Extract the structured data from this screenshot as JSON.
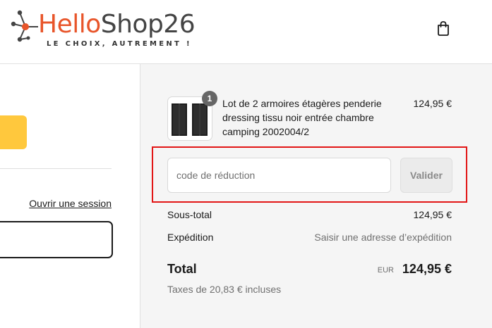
{
  "header": {
    "logo": {
      "part1": "Hello",
      "part2": "Shop26",
      "tagline": "LE CHOIX, AUTREMENT !"
    },
    "cart_icon": "shopping-bag-icon"
  },
  "left": {
    "login_link": "Ouvrir une session"
  },
  "summary": {
    "item": {
      "quantity": "1",
      "name": "Lot de 2 armoires étagères penderie dressing tissu noir entrée chambre camping 2002004/2",
      "price": "124,95 €"
    },
    "discount": {
      "placeholder": "code de réduction",
      "value": "",
      "button_label": "Valider"
    },
    "subtotal": {
      "label": "Sous-total",
      "value": "124,95 €"
    },
    "shipping": {
      "label": "Expédition",
      "value": "Saisir une adresse d’expédition"
    },
    "total": {
      "label": "Total",
      "currency": "EUR",
      "value": "124,95 €"
    },
    "taxes": "Taxes de 20,83 € incluses"
  },
  "colors": {
    "brand_orange": "#e8552a",
    "brand_gray": "#444444",
    "accent_yellow": "#ffc83d",
    "highlight_red": "#e21616",
    "summary_bg": "#f5f5f5"
  }
}
